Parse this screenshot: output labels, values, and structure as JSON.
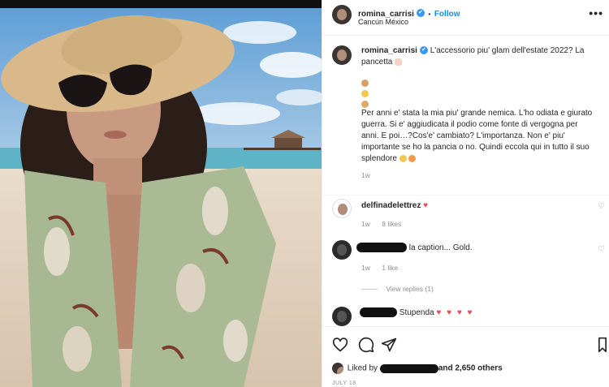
{
  "post": {
    "username": "romina_carrisi",
    "verified_mark": "✔",
    "follow_label": "Follow",
    "separator": "•",
    "location": "Cancún México",
    "more_icon": "more-dots-icon",
    "more_label": "•••"
  },
  "caption": {
    "username": "romina_carrisi",
    "line1": "L'accessorio piu' glam dell'estate 2022? La",
    "line2": "pancetta",
    "body_lines": [
      "Per anni e' stata la mia piu' grande nemica. L'ho odiata e giurato",
      "guerra. Si e' aggiudicata il podio come fonte di vergogna per",
      "anni. E poi…?Cos'e' cambiato? L'importanza. Non e' piu'",
      "importante se ho la pancia o no. Quindi eccola qui in tutto il suo",
      "splendore"
    ],
    "time": "1w"
  },
  "comments": [
    {
      "username": "delfinadelettrez",
      "text": "",
      "time": "1w",
      "likes": "8 likes",
      "heart": "♥"
    },
    {
      "username": "",
      "text": "la caption... Gold.",
      "time": "1w",
      "likes": "1 like"
    },
    {
      "view_replies": "View replies (1)"
    },
    {
      "username": "",
      "text": "Stupenda",
      "hearts": "♥ ♥ ♥ ♥"
    }
  ],
  "actions": {
    "liked_prefix": "Liked by",
    "liked_suffix": "and 2,650 others",
    "date": "JULY 18"
  },
  "colors": {
    "accent": "#0095f6",
    "verified": "#3897f0",
    "heart": "#ed4956",
    "muted": "#8e8e8e"
  }
}
